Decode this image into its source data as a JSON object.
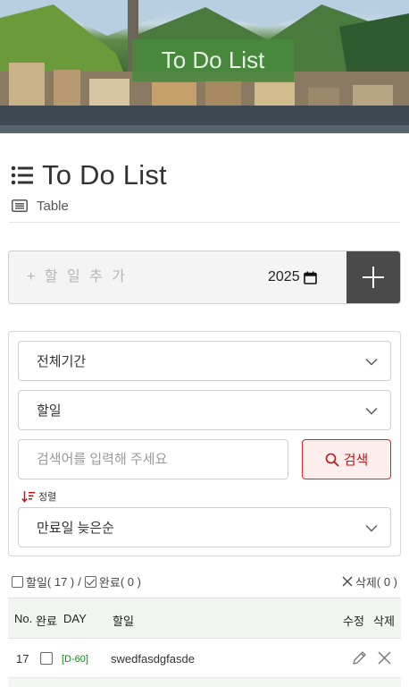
{
  "banner": {
    "title": "To Do List"
  },
  "header": {
    "title": "To Do List",
    "view_label": "Table"
  },
  "add_form": {
    "placeholder": "+ 할 일 추 가",
    "date_value": "2025"
  },
  "filters": {
    "period": "전체기간",
    "field": "할일",
    "search_placeholder": "검색어를 입력해 주세요",
    "search_button": "검색",
    "sort_label": "정렬",
    "sort_value": "만료일 늦은순"
  },
  "summary": {
    "todo_label": "할일",
    "todo_count": "( 17 )",
    "separator": "/",
    "done_label": "완료",
    "done_count": "( 0 )",
    "delete_label": "삭제",
    "delete_count": "( 0 )"
  },
  "table": {
    "columns": {
      "no": "No.",
      "done": "완료",
      "day": "DAY",
      "task": "할일",
      "edit": "수정",
      "delete": "삭제"
    },
    "rows": [
      {
        "no": "17",
        "dday": "[D-60]",
        "task": "swedfasdgfasde"
      }
    ]
  },
  "colors": {
    "accent_red": "#c0141b",
    "banner_box": "#468c3c",
    "dday_green": "#0d8a16",
    "add_button": "#4a4a4a"
  }
}
